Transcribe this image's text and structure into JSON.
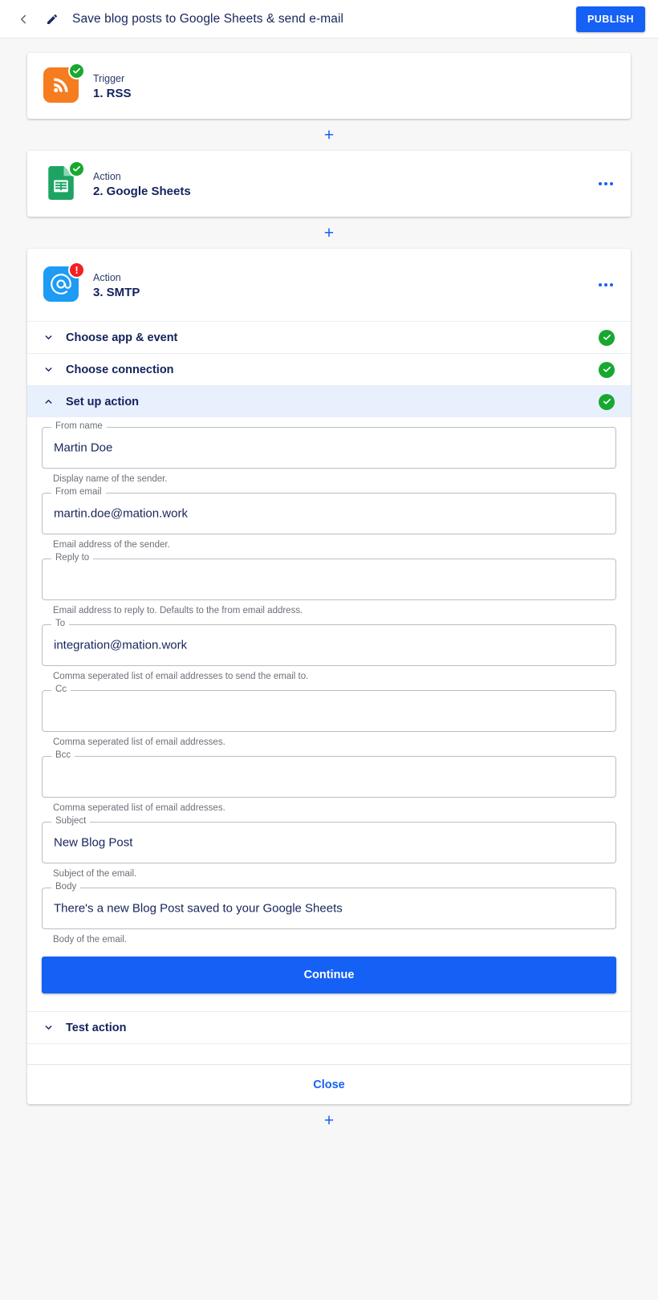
{
  "header": {
    "back_icon": "chevron-left-icon",
    "edit_icon": "pencil-icon",
    "title": "Save blog posts to Google Sheets & send e-mail",
    "publish_label": "PUBLISH",
    "accent_color": "#1560f5"
  },
  "connector": {
    "add_label": "+"
  },
  "steps": [
    {
      "kind": "Trigger",
      "name": "1. RSS",
      "icon": "rss-icon",
      "icon_color": "#f57c1f",
      "status": "ok",
      "status_icon": "check-circle-icon",
      "has_menu": false
    },
    {
      "kind": "Action",
      "name": "2. Google Sheets",
      "icon": "google-sheets-icon",
      "icon_color": "#1da462",
      "status": "ok",
      "status_icon": "check-circle-icon",
      "has_menu": true,
      "menu_icon": "more-horizontal-icon"
    },
    {
      "kind": "Action",
      "name": "3. SMTP",
      "icon": "smtp-at-icon",
      "icon_color": "#1d9bf5",
      "status": "error",
      "status_icon": "alert-circle-icon",
      "has_menu": true,
      "menu_icon": "more-horizontal-icon"
    }
  ],
  "accordion": [
    {
      "label": "Choose app & event",
      "expanded": false,
      "chevron": "chevron-down-icon",
      "complete": true
    },
    {
      "label": "Choose connection",
      "expanded": false,
      "chevron": "chevron-down-icon",
      "complete": true
    },
    {
      "label": "Set up action",
      "expanded": true,
      "chevron": "chevron-up-icon",
      "complete": true
    }
  ],
  "form": {
    "fields": [
      {
        "label": "From name",
        "value": "Martin Doe",
        "placeholder": "",
        "helper": "Display name of the sender."
      },
      {
        "label": "From email",
        "value": "martin.doe@mation.work",
        "placeholder": "",
        "helper": "Email address of the sender."
      },
      {
        "label": "Reply to",
        "value": "",
        "placeholder": "",
        "helper": "Email address to reply to. Defaults to the from email address."
      },
      {
        "label": "To",
        "value": "integration@mation.work",
        "placeholder": "",
        "helper": "Comma seperated list of email addresses to send the email to."
      },
      {
        "label": "Cc",
        "value": "",
        "placeholder": "",
        "helper": "Comma seperated list of email addresses."
      },
      {
        "label": "Bcc",
        "value": "",
        "placeholder": "",
        "helper": "Comma seperated list of email addresses."
      },
      {
        "label": "Subject",
        "value": "New Blog Post",
        "placeholder": "",
        "helper": "Subject of the email."
      },
      {
        "label": "Body",
        "value": "There's a new Blog Post saved to your Google Sheets",
        "placeholder": "",
        "helper": "Body of the email."
      }
    ],
    "continue_label": "Continue"
  },
  "test_section": {
    "label": "Test action",
    "chevron": "chevron-down-icon",
    "expanded": false
  },
  "footer": {
    "close_label": "Close"
  }
}
